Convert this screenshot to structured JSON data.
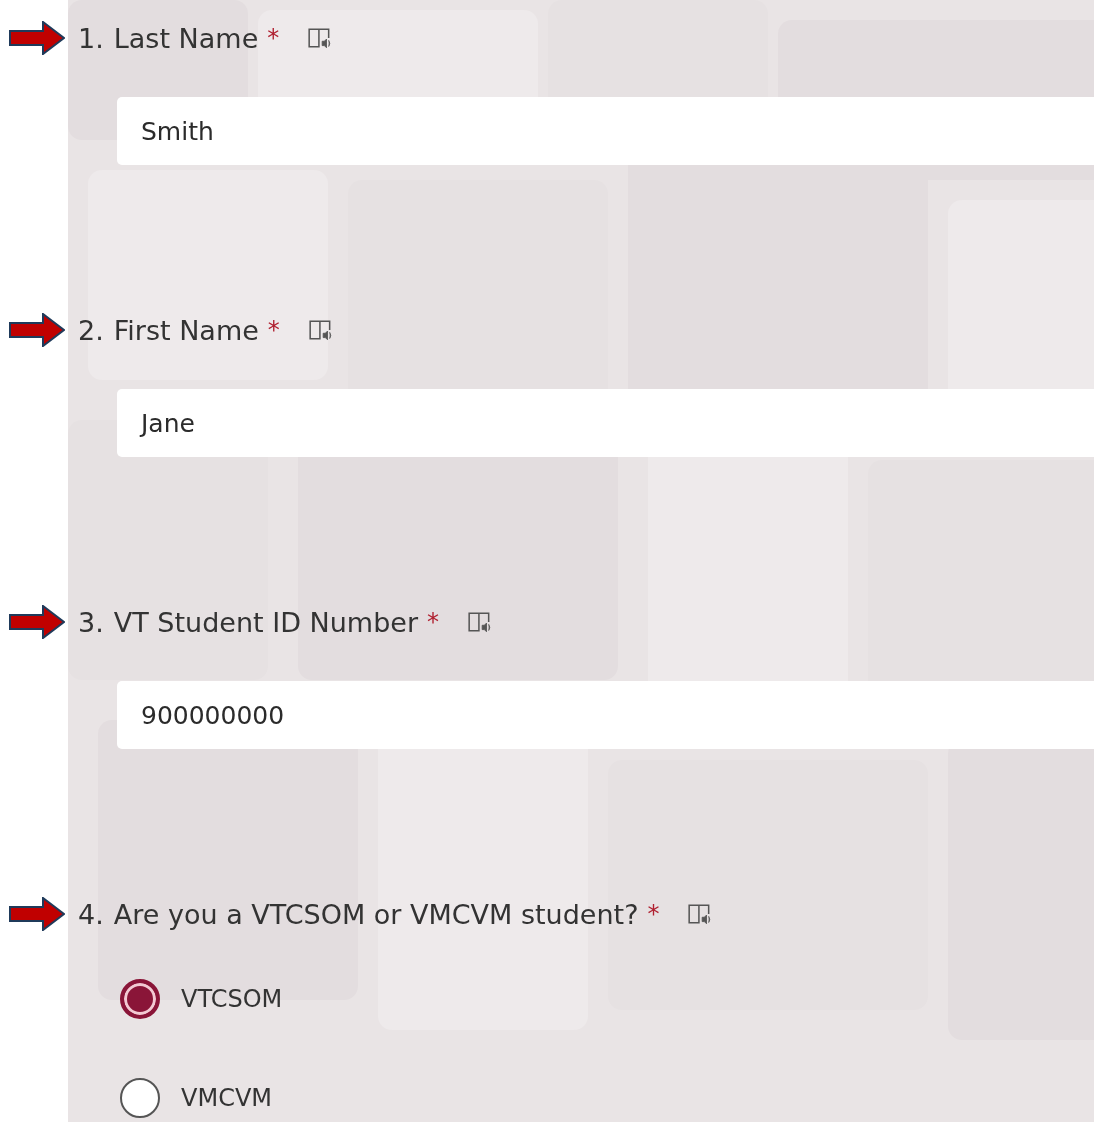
{
  "questions": [
    {
      "number": "1.",
      "title": "Last Name",
      "required_mark": "*",
      "marked": true,
      "kind": "text",
      "value": "Smith"
    },
    {
      "number": "2.",
      "title": "First Name",
      "required_mark": "*",
      "marked": true,
      "kind": "text",
      "value": "Jane"
    },
    {
      "number": "3.",
      "title": "VT Student ID Number",
      "required_mark": "*",
      "marked": true,
      "kind": "text",
      "value": "900000000"
    },
    {
      "number": "4.",
      "title": "Are you a VTCSOM or VMCVM student?",
      "required_mark": "*",
      "marked": true,
      "kind": "choice",
      "options": [
        {
          "label": "VTCSOM",
          "selected": true
        },
        {
          "label": "VMCVM",
          "selected": false
        }
      ]
    }
  ]
}
